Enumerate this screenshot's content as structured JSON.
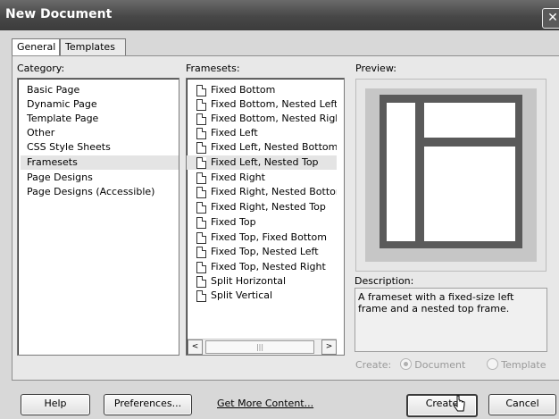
{
  "window": {
    "title": "New Document",
    "close_symbol": "✕"
  },
  "tabs": [
    {
      "label": "General",
      "active": true
    },
    {
      "label": "Templates",
      "active": false
    }
  ],
  "category": {
    "label": "Category:",
    "items": [
      "Basic Page",
      "Dynamic Page",
      "Template Page",
      "Other",
      "CSS Style Sheets",
      "Framesets",
      "Page Designs",
      "Page Designs (Accessible)"
    ],
    "selected": "Framesets"
  },
  "framesets": {
    "label": "Framesets:",
    "items": [
      "Fixed Bottom",
      "Fixed Bottom, Nested Left",
      "Fixed Bottom, Nested Right",
      "Fixed Left",
      "Fixed Left, Nested Bottom",
      "Fixed Left, Nested Top",
      "Fixed Right",
      "Fixed Right, Nested Bottom",
      "Fixed Right, Nested Top",
      "Fixed Top",
      "Fixed Top, Fixed Bottom",
      "Fixed Top, Nested Left",
      "Fixed Top, Nested Right",
      "Split Horizontal",
      "Split Vertical"
    ],
    "selected": "Fixed Left, Nested Top",
    "scroll_left": "<",
    "scroll_right": ">",
    "thumb_grip": "|||"
  },
  "preview": {
    "label": "Preview:"
  },
  "description": {
    "label": "Description:",
    "text": "A frameset with a fixed-size left frame and a nested top frame."
  },
  "create_as": {
    "label": "Create:",
    "options": [
      "Document",
      "Template"
    ],
    "selected": "Document"
  },
  "buttons": {
    "help": "Help",
    "preferences": "Preferences...",
    "get_more": "Get More Content...",
    "create": "Create",
    "cancel": "Cancel"
  }
}
